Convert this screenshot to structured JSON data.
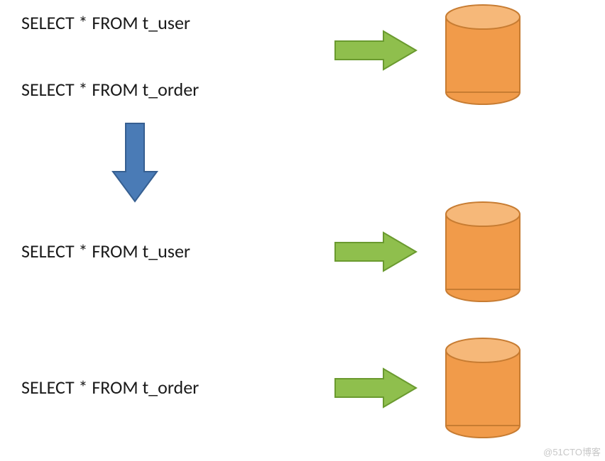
{
  "sql": {
    "top1": "SELECT * FROM t_user",
    "top2": "SELECT * FROM t_order",
    "bot1": "SELECT * FROM t_user",
    "bot2": "SELECT * FROM t_order"
  },
  "watermark": "@51CTO博客",
  "colors": {
    "green_fill": "#8fbf4d",
    "green_stroke": "#6a9a2f",
    "blue_fill": "#4a7bb6",
    "blue_stroke": "#365f91",
    "orange_fill": "#f19b4a",
    "orange_stroke": "#c77c32"
  }
}
